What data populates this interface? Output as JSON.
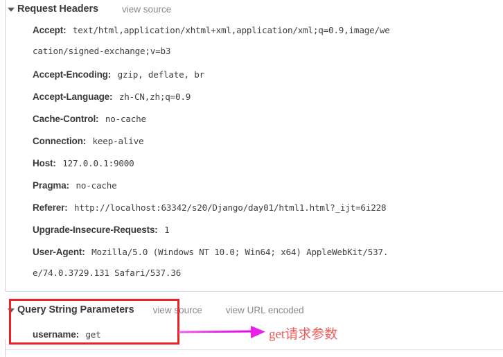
{
  "panel": {
    "name": "network-request-headers-panel"
  },
  "request_headers_section": {
    "title": "Request Headers",
    "expanded": true,
    "view_source_label": "view source",
    "headers": [
      {
        "name": "Accept:",
        "value": "text/html,application/xhtml+xml,application/xml;q=0.9,image/we",
        "continuation": "cation/signed-exchange;v=b3"
      },
      {
        "name": "Accept-Encoding:",
        "value": "gzip, deflate, br",
        "continuation": null
      },
      {
        "name": "Accept-Language:",
        "value": "zh-CN,zh;q=0.9",
        "continuation": null
      },
      {
        "name": "Cache-Control:",
        "value": "no-cache",
        "continuation": null
      },
      {
        "name": "Connection:",
        "value": "keep-alive",
        "continuation": null
      },
      {
        "name": "Host:",
        "value": "127.0.0.1:9000",
        "continuation": null
      },
      {
        "name": "Pragma:",
        "value": "no-cache",
        "continuation": null
      },
      {
        "name": "Referer:",
        "value": "http://localhost:63342/s20/Django/day01/html1.html?_ijt=6i228",
        "continuation": null
      },
      {
        "name": "Upgrade-Insecure-Requests:",
        "value": "1",
        "continuation": null
      },
      {
        "name": "User-Agent:",
        "value": "Mozilla/5.0 (Windows NT 10.0; Win64; x64) AppleWebKit/537.",
        "continuation": "e/74.0.3729.131 Safari/537.36"
      }
    ]
  },
  "query_string_section": {
    "title": "Query String Parameters",
    "expanded": true,
    "view_source_label": "view source",
    "view_url_encoded_label": "view URL encoded",
    "params": [
      {
        "name": "username:",
        "value": "get"
      }
    ]
  },
  "annotations": {
    "highlight_box_color": "#ee2222",
    "arrow_color": "#e828e8",
    "note_text": "get请求参数",
    "note_color": "#f25c5c"
  }
}
